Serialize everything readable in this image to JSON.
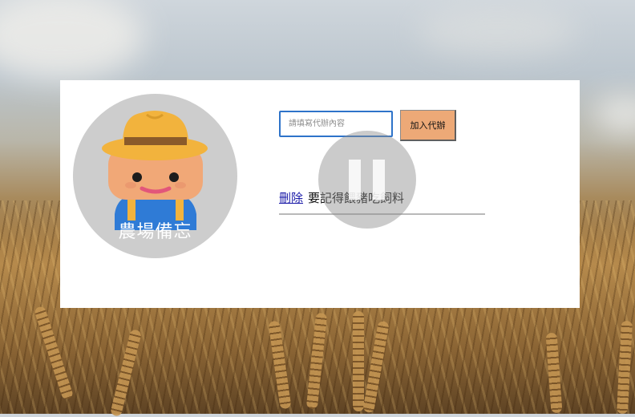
{
  "app": {
    "logo_title": "農場備忘"
  },
  "form": {
    "input_placeholder": "請填寫代辦內容",
    "input_value": "",
    "add_button_label": "加入代辦"
  },
  "todos": [
    {
      "delete_label": "刪除",
      "text": "要記得餵豬吃飼料"
    }
  ],
  "overlay": {
    "icon": "pause-icon"
  },
  "colors": {
    "card_bg": "#ffffff",
    "logo_circle": "#cdcdcd",
    "button_bg": "#eda977",
    "input_border": "#2e73c9",
    "link": "#1a1aa8"
  }
}
